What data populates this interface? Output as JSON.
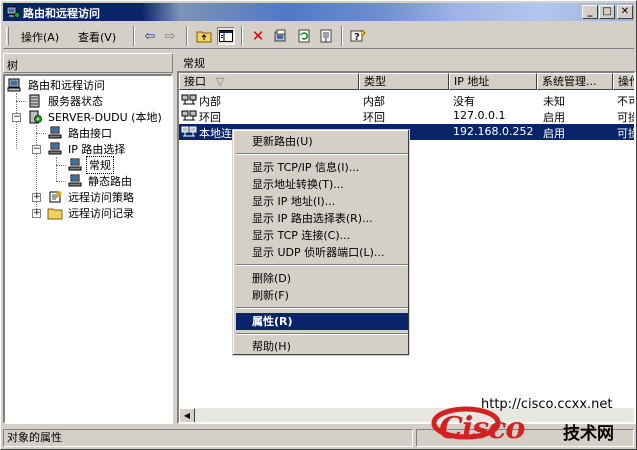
{
  "window": {
    "title": "路由和远程访问"
  },
  "menubar": {
    "action": "操作(A)",
    "view": "查看(V)"
  },
  "tree": {
    "header": "树",
    "root": "路由和远程访问",
    "server_status": "服务器状态",
    "server": "SERVER-DUDU (本地)",
    "routing_interfaces": "路由接口",
    "ip_routing": "IP 路由选择",
    "general": "常规",
    "static_routes": "静态路由",
    "remote_access_policies": "远程访问策略",
    "remote_access_logging": "远程访问记录"
  },
  "list": {
    "title": "常规",
    "columns": [
      "接口",
      "类型",
      "IP 地址",
      "系统管理...",
      "操作"
    ],
    "rows": [
      {
        "name": "内部",
        "type": "内部",
        "ip": "没有",
        "admin": "未知",
        "op": "不可"
      },
      {
        "name": "环回",
        "type": "环回",
        "ip": "127.0.0.1",
        "admin": "启用",
        "op": "可操"
      },
      {
        "name": "本地连",
        "type": "",
        "ip": "192.168.0.252",
        "admin": "启用",
        "op": "可操"
      }
    ]
  },
  "context_menu": {
    "update_routes": "更新路由(U)",
    "show_tcpip": "显示 TCP/IP 信息(I)...",
    "show_nat": "显示地址转换(T)...",
    "show_ip": "显示 IP 地址(I)...",
    "show_routing_table": "显示 IP 路由选择表(R)...",
    "show_tcp": "显示 TCP 连接(C)...",
    "show_udp": "显示 UDP 侦听器端口(L)...",
    "delete": "删除(D)",
    "refresh": "刷新(F)",
    "properties": "属性(R)",
    "help": "帮助(H)"
  },
  "status": {
    "text": "对象的属性"
  },
  "watermark": {
    "url": "http://cisco.ccxx.net",
    "brand": "Cisco",
    "tagline": "技术网"
  },
  "colors": {
    "title_active": "#0a246a",
    "selection": "#0a246a",
    "face": "#d4d0c8",
    "brand_red": "#d42020"
  }
}
